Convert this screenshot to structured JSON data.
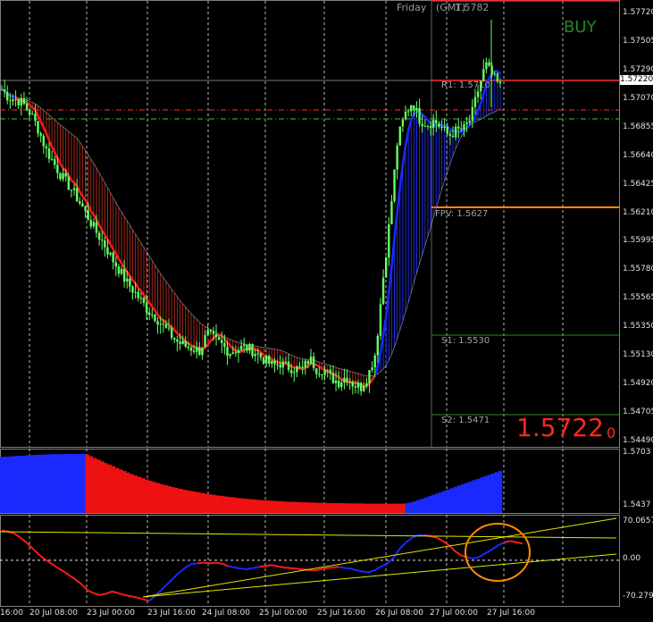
{
  "chart_header": {
    "day": "Friday",
    "gmt": "(GMT)",
    "high_value": "1.5782"
  },
  "signal": {
    "label": "BUY",
    "color": "#1e8a1e"
  },
  "big_price": {
    "main": "1.5722",
    "small": "0"
  },
  "levels": {
    "r1": "R1:  1.5710",
    "fpv": "FPV:  1.5627",
    "s1": "S1:  1.5530",
    "s2": "S2:  1.5471"
  },
  "current_price": "1.57220",
  "colors": {
    "bull": "#66ff66",
    "up_line": "#1a2aff",
    "down_line": "#ff1a1a",
    "orange": "#ff8c00",
    "grid": "#ffffff"
  },
  "chart_data": [
    {
      "type": "candlestick",
      "panel": "price",
      "y_ticks": [
        "1.57720",
        "1.57505",
        "1.57290",
        "1.57070",
        "1.56855",
        "1.56640",
        "1.56425",
        "1.56210",
        "1.55995",
        "1.55780",
        "1.55565",
        "1.55350",
        "1.55130",
        "1.54920",
        "1.54705",
        "1.54490"
      ],
      "ylim": [
        1.544,
        1.578
      ],
      "price_path": [
        1.572,
        1.5713,
        1.5712,
        1.5708,
        1.57,
        1.5688,
        1.5672,
        1.5662,
        1.5652,
        1.5644,
        1.5636,
        1.5626,
        1.5615,
        1.5605,
        1.5596,
        1.5585,
        1.5576,
        1.5566,
        1.5559,
        1.5551,
        1.5543,
        1.5538,
        1.5531,
        1.5524,
        1.5518,
        1.5515,
        1.5513,
        1.5511,
        1.5525,
        1.552,
        1.5516,
        1.551,
        1.5512,
        1.5514,
        1.5512,
        1.5508,
        1.5503,
        1.5499,
        1.5501,
        1.5498,
        1.5497,
        1.5496,
        1.5505,
        1.5496,
        1.5496,
        1.5489,
        1.5486,
        1.5491,
        1.5484,
        1.5482,
        1.5492,
        1.551,
        1.5568,
        1.562,
        1.568,
        1.57,
        1.571,
        1.5696,
        1.5692,
        1.5695,
        1.5689,
        1.5683,
        1.5687,
        1.5688,
        1.5697,
        1.572,
        1.574,
        1.573,
        1.5722
      ]
    },
    {
      "type": "bar",
      "panel": "histogram",
      "y_ticks": [
        "1.5703",
        "1.5437"
      ],
      "ylim": [
        1.5437,
        1.5703
      ],
      "values": [
        1.569,
        1.5691,
        1.5692,
        1.5693,
        1.5694,
        1.5695,
        1.5696,
        1.5697,
        1.5698,
        1.5699,
        1.57,
        1.57,
        1.5701,
        1.5701,
        1.5702,
        1.5702,
        1.5702,
        1.5703,
        1.5703,
        1.5703,
        1.5703,
        1.5703,
        1.5703,
        1.57,
        1.5693,
        1.5685,
        1.5678,
        1.567,
        1.5662,
        1.5655,
        1.5648,
        1.564,
        1.5633,
        1.5626,
        1.5619,
        1.5612,
        1.5606,
        1.56,
        1.5594,
        1.5588,
        1.5582,
        1.5577,
        1.5572,
        1.5567,
        1.5563,
        1.5558,
        1.5554,
        1.555,
        1.5546,
        1.5542,
        1.5539,
        1.5536,
        1.5533,
        1.553,
        1.5527,
        1.5524,
        1.5521,
        1.5519,
        1.5516,
        1.5514,
        1.5512,
        1.551,
        1.5508,
        1.5506,
        1.5504,
        1.5502,
        1.5501,
        1.5499,
        1.5498,
        1.5496,
        1.5495,
        1.5494,
        1.5493,
        1.5492,
        1.5491,
        1.549,
        1.5489,
        1.5488,
        1.5487,
        1.5487,
        1.5486,
        1.5485,
        1.5485,
        1.5484,
        1.5484,
        1.5483,
        1.5483,
        1.5482,
        1.5482,
        1.5482,
        1.5481,
        1.5481,
        1.5481,
        1.548,
        1.548,
        1.548,
        1.548,
        1.548,
        1.5479,
        1.5479,
        1.5479,
        1.5479,
        1.5479,
        1.5479,
        1.5479,
        1.5479,
        1.5479,
        1.5479,
        1.5479,
        1.5481,
        1.5485,
        1.549,
        1.5495,
        1.5501,
        1.5507,
        1.5513,
        1.5519,
        1.5525,
        1.5531,
        1.5537,
        1.5543,
        1.5549,
        1.5555,
        1.5561,
        1.5567,
        1.5573,
        1.5579,
        1.5585,
        1.5591,
        1.5597,
        1.5603,
        1.5609,
        1.5615,
        1.5621,
        1.5627
      ],
      "series_colors_by_index": {
        "blue_until": 22,
        "red_until": 108
      }
    },
    {
      "type": "line",
      "panel": "oscillator",
      "y_ticks": [
        "70.0657",
        "0.00",
        "-70.2799"
      ],
      "ylim": [
        -70.2799,
        70.0657
      ],
      "values": [
        50,
        48,
        45,
        38,
        30,
        20,
        10,
        2,
        -5,
        -12,
        -18,
        -25,
        -32,
        -40,
        -50,
        -55,
        -58,
        -56,
        -52,
        -55,
        -58,
        -60,
        -62,
        -65,
        -68,
        -60,
        -50,
        -40,
        -30,
        -20,
        -12,
        -6,
        -5,
        -4,
        -5,
        -4,
        -6,
        -10,
        -12,
        -14,
        -15,
        -13,
        -11,
        -10,
        -8,
        -10,
        -12,
        -13,
        -14,
        -15,
        -16,
        -17,
        -15,
        -13,
        -12,
        -11,
        -13,
        -14,
        -17,
        -19,
        -20,
        -16,
        -10,
        -5,
        5,
        20,
        30,
        38,
        42,
        42,
        40,
        38,
        32,
        25,
        15,
        8,
        5,
        3,
        6,
        12,
        18,
        25,
        30,
        32,
        30,
        28
      ],
      "bull_segments": [
        [
          25,
          33
        ],
        [
          38,
          43
        ],
        [
          56,
          70
        ],
        [
          77,
          83
        ]
      ],
      "trendlines": "yellow"
    }
  ],
  "x_ticks": [
    "16:00",
    "20 Jul 08:00",
    "23 Jul 00:00",
    "23 Jul 16:00",
    "24 Jul 08:00",
    "25 Jul 00:00",
    "25 Jul 16:00",
    "26 Jul 08:00",
    "27 Jul 00:00",
    "27 Jul 16:00"
  ]
}
